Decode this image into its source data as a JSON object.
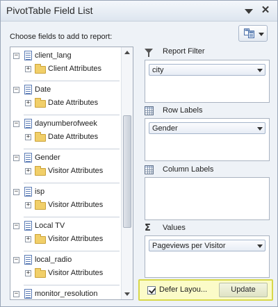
{
  "window": {
    "title": "PivotTable Field List",
    "close_glyph": "✕"
  },
  "choose_label": "Choose fields to add to report:",
  "field_list": [
    {
      "name": "client_lang",
      "child": "Client Attributes"
    },
    {
      "name": "Date",
      "child": "Date Attributes"
    },
    {
      "name": "daynumberofweek",
      "child": "Date Attributes"
    },
    {
      "name": "Gender",
      "child": "Visitor Attributes"
    },
    {
      "name": "isp",
      "child": "Visitor Attributes"
    },
    {
      "name": "Local TV",
      "child": "Visitor Attributes"
    },
    {
      "name": "local_radio",
      "child": "Visitor Attributes"
    },
    {
      "name": "monitor_resolution",
      "child": ""
    }
  ],
  "tree_toggle": {
    "collapse": "−",
    "expand": "+"
  },
  "areas": {
    "report_filter": {
      "label": "Report Filter",
      "icon": "filter-icon",
      "field": "city"
    },
    "row_labels": {
      "label": "Row Labels",
      "icon": "row-grid-icon",
      "field": "Gender"
    },
    "column_labels": {
      "label": "Column Labels",
      "icon": "column-grid-icon",
      "field": ""
    },
    "values": {
      "label": "Values",
      "icon": "sigma-icon",
      "field": "Pageviews per Visitor"
    }
  },
  "sigma_glyph": "Σ",
  "defer": {
    "label": "Defer Layou...",
    "checked": true
  },
  "update_label": "Update",
  "colors": {
    "highlight_bg": "#fbfbc8",
    "highlight_border": "#d8d84a",
    "panel_bg": "#eef2f7"
  }
}
